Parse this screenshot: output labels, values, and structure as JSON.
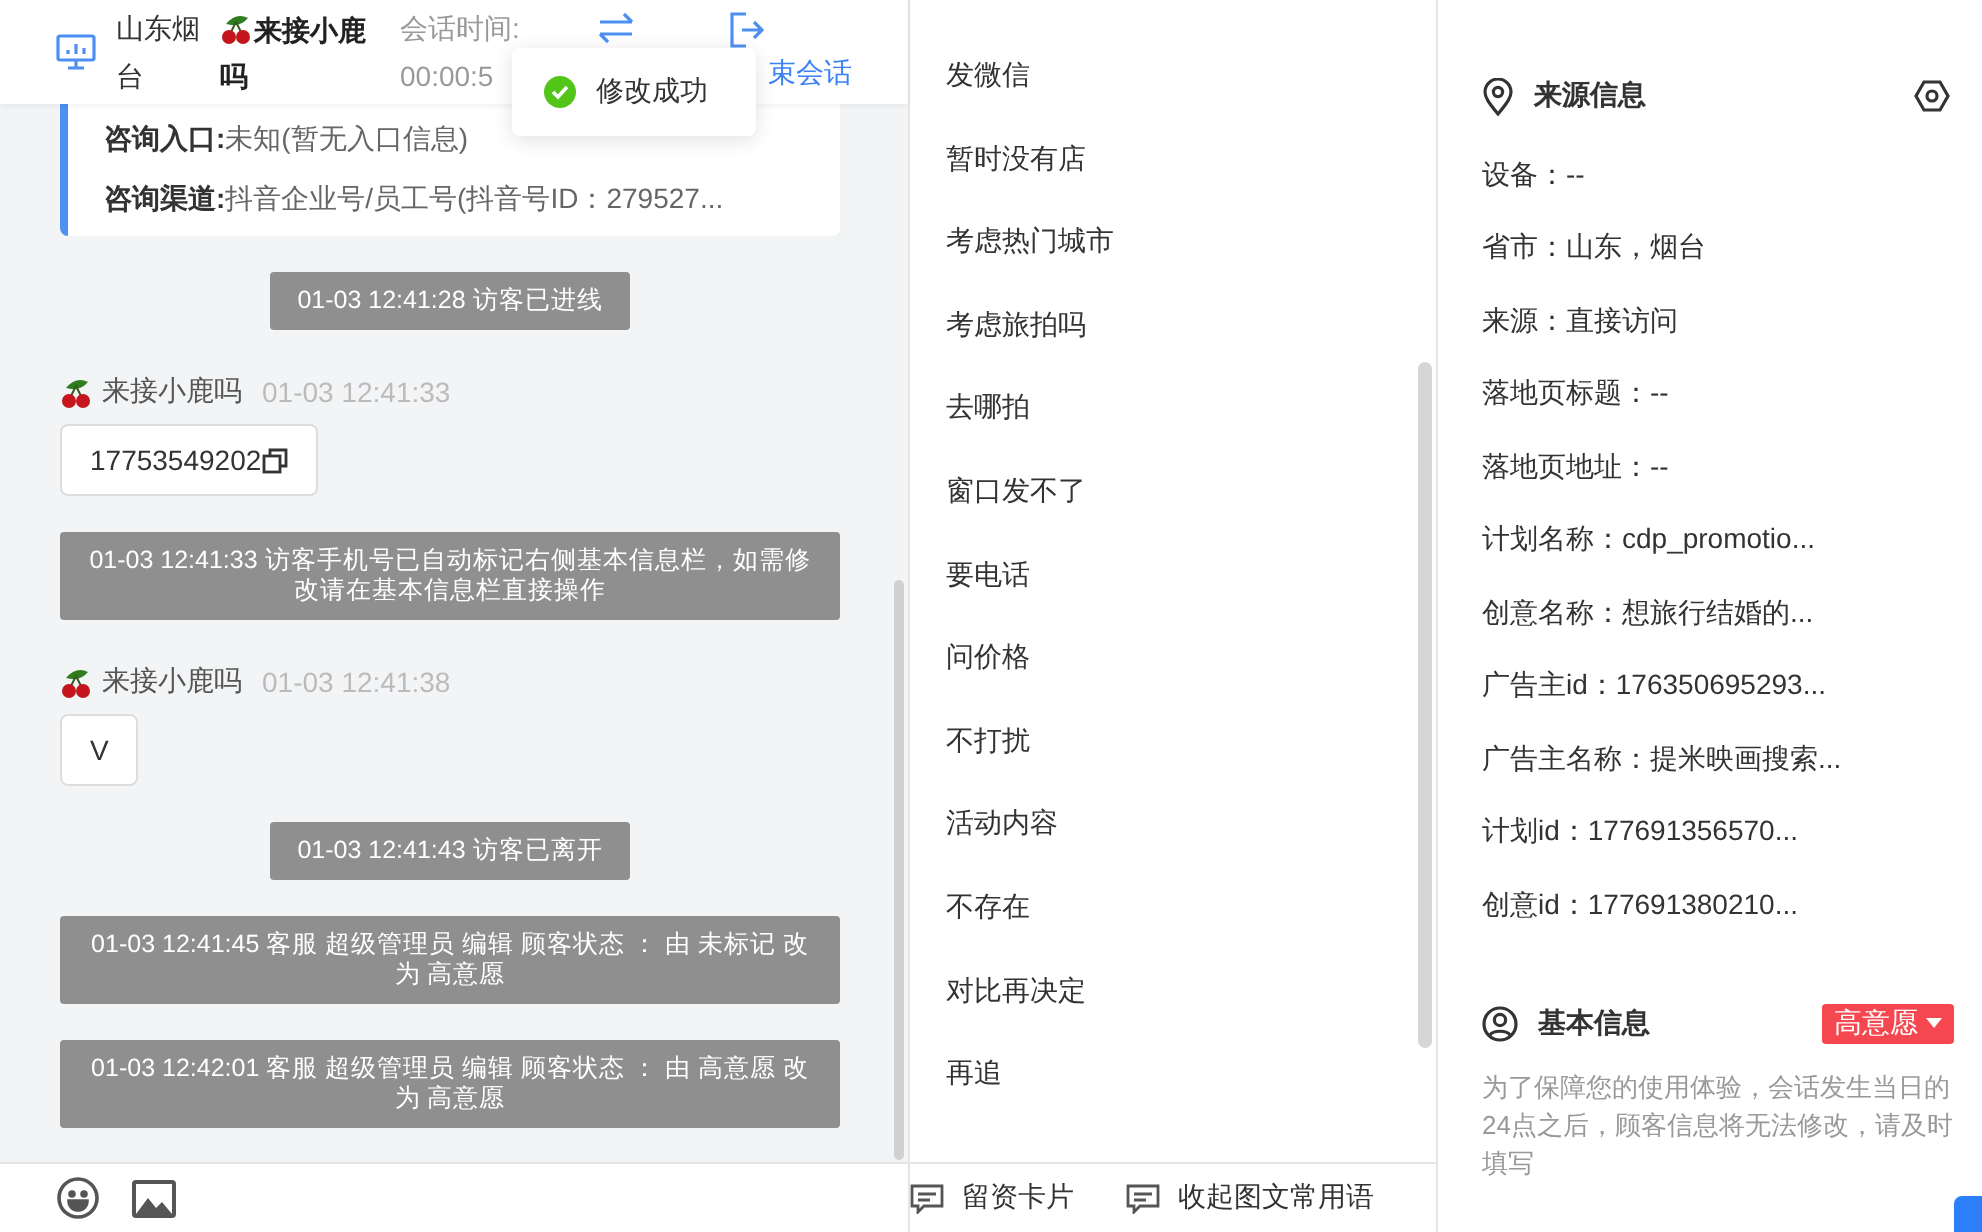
{
  "header": {
    "location": "山东烟台",
    "agent_name": "来接小鹿吗",
    "session_label": "会话时间:",
    "session_time": "00:00:5",
    "end_label": "束会话"
  },
  "toast": {
    "text": "修改成功"
  },
  "entry_card": {
    "rows": [
      {
        "label": "咨询入口:",
        "value": "未知(暂无入口信息)"
      },
      {
        "label": "咨询渠道:",
        "value": "抖音企业号/员工号(抖音号ID：279527..."
      }
    ]
  },
  "messages": [
    {
      "kind": "system",
      "text": "01-03 12:41:28 访客已进线"
    },
    {
      "kind": "user",
      "sender": "来接小鹿吗",
      "time": "01-03 12:41:33",
      "content": "17753549202",
      "copyable": true
    },
    {
      "kind": "notice",
      "text": "01-03 12:41:33 访客手机号已自动标记右侧基本信息栏，如需修改请在基本信息栏直接操作"
    },
    {
      "kind": "user",
      "sender": "来接小鹿吗",
      "time": "01-03 12:41:38",
      "content": "V",
      "copyable": false
    },
    {
      "kind": "system",
      "text": "01-03 12:41:43 访客已离开"
    },
    {
      "kind": "notice",
      "text": "01-03 12:41:45 客服 超级管理员 编辑 顾客状态 ： 由 未标记 改为 高意愿"
    },
    {
      "kind": "notice",
      "text": "01-03 12:42:01 客服 超级管理员 编辑 顾客状态 ： 由 高意愿 改为 高意愿"
    }
  ],
  "quick_replies": [
    "发微信",
    "暂时没有店",
    "考虑热门城市",
    "考虑旅拍吗",
    "去哪拍",
    "窗口发不了",
    "要电话",
    "问价格",
    "不打扰",
    "活动内容",
    "不存在",
    "对比再决定",
    "再追"
  ],
  "bottom_actions": [
    "留资卡片",
    "收起图文常用语"
  ],
  "source_info": {
    "title": "来源信息",
    "rows": [
      "设备：--",
      "省市：山东，烟台",
      "来源：直接访问",
      "落地页标题：--",
      "落地页地址：--",
      "计划名称：cdp_promotio...",
      "创意名称：想旅行结婚的...",
      "广告主id：176350695293...",
      "广告主名称：提米映画搜索...",
      "计划id：177691356570...",
      "创意id：177691380210..."
    ]
  },
  "basic_info": {
    "title": "基本信息",
    "status": {
      "label": "高意愿",
      "color": "#f5474f"
    },
    "note": "为了保障您的使用体验，会话发生当日的24点之后，顾客信息将无法修改，请及时填写"
  }
}
